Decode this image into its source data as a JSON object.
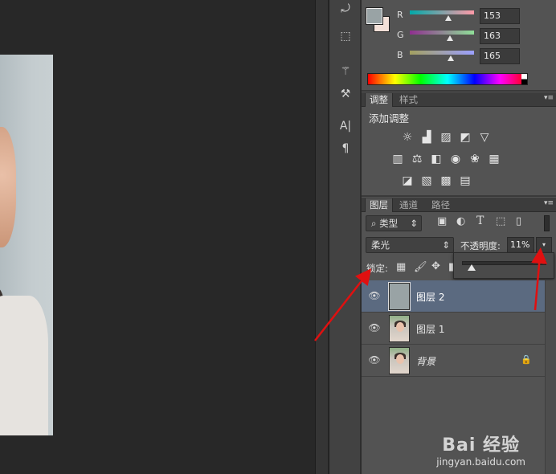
{
  "color_panel": {
    "channels": [
      {
        "label": "R",
        "value": "153",
        "colors": [
          "#00a9a8",
          "#ff9aa8"
        ]
      },
      {
        "label": "G",
        "value": "163",
        "colors": [
          "#8f2f8f",
          "#8fdf98"
        ]
      },
      {
        "label": "B",
        "value": "165",
        "colors": [
          "#a3a060",
          "#9ca0ff"
        ]
      }
    ],
    "foreground": "#99a3a5",
    "background": "#f3e0d8"
  },
  "adjustments": {
    "tabs": [
      "调整",
      "样式"
    ],
    "title": "添加调整",
    "icons_row1": [
      "brightness-contrast-icon",
      "levels-icon",
      "curves-icon",
      "exposure-icon",
      "vibrance-icon"
    ],
    "icons_row2": [
      "hue-saturation-icon",
      "color-balance-icon",
      "black-white-icon",
      "photo-filter-icon",
      "channel-mixer-icon",
      "color-lookup-icon"
    ],
    "icons_row3": [
      "invert-icon",
      "posterize-icon",
      "threshold-icon",
      "gradient-map-icon"
    ]
  },
  "layers": {
    "tabs": [
      "图层",
      "通道",
      "路径"
    ],
    "filter_label": "类型",
    "blend_mode": "柔光",
    "opacity_label": "不透明度:",
    "opacity_value": "11%",
    "opacity_fraction": 0.11,
    "lock_label": "锁定:",
    "items": [
      {
        "name": "图层 2",
        "selected": true,
        "thumb": "gray"
      },
      {
        "name": "图层 1",
        "selected": false,
        "thumb": "photo"
      },
      {
        "name": "背景",
        "selected": false,
        "thumb": "photo",
        "locked": true
      }
    ]
  },
  "watermark": {
    "logo": "Bai 经验",
    "url": "jingyan.baidu.com"
  },
  "annotation_color": "#e01010"
}
